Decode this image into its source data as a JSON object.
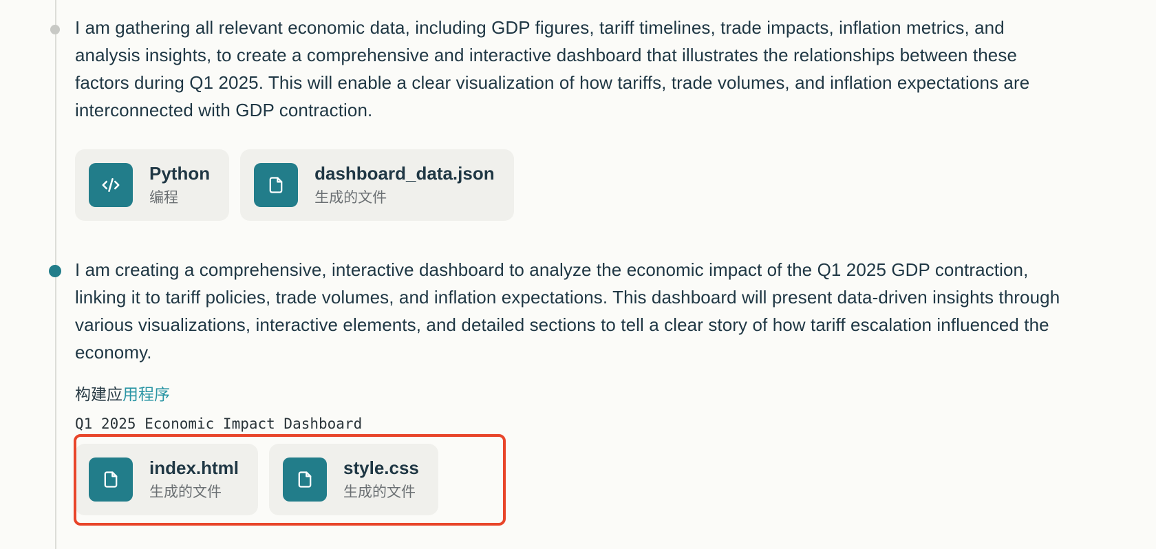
{
  "colors": {
    "accent": "#227d8a",
    "highlight": "#e8452a",
    "link": "#2a95a4"
  },
  "steps": [
    {
      "text": "I am gathering all relevant economic data, including GDP figures, tariff timelines, trade impacts, inflation metrics, and analysis insights, to create a comprehensive and interactive dashboard that illustrates the relationships between these factors during Q1 2025. This will enable a clear visualization of how tariffs, trade volumes, and inflation expectations are interconnected with GDP contraction.",
      "cards": [
        {
          "icon": "code-icon",
          "title": "Python",
          "subtitle": "编程"
        },
        {
          "icon": "file-icon",
          "title": "dashboard_data.json",
          "subtitle": "生成的文件"
        }
      ]
    },
    {
      "text": "I am creating a comprehensive, interactive dashboard to analyze the economic impact of the Q1 2025 GDP contraction, linking it to tariff policies, trade volumes, and inflation expectations. This dashboard will present data-driven insights through various visualizations, interactive elements, and detailed sections to tell a clear story of how tariff escalation influenced the economy.",
      "build_label_prefix": "构建应",
      "build_label_accent": "用程序",
      "app_name": "Q1 2025 Economic Impact Dashboard",
      "cards": [
        {
          "icon": "file-icon",
          "title": "index.html",
          "subtitle": "生成的文件"
        },
        {
          "icon": "file-icon",
          "title": "style.css",
          "subtitle": "生成的文件"
        }
      ]
    }
  ]
}
